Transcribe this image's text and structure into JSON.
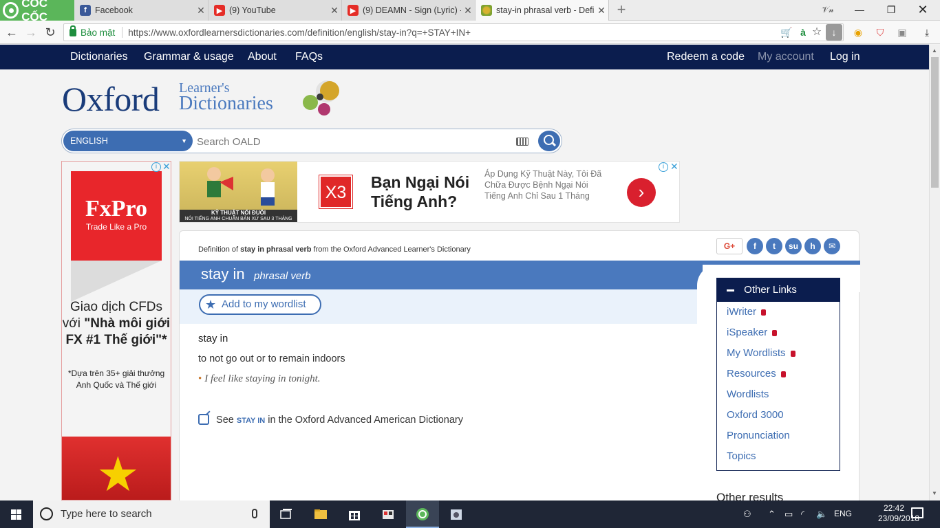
{
  "browser": {
    "brand": "CỐC CỐC",
    "tabs": [
      {
        "title": "Facebook",
        "icon": "facebook-icon"
      },
      {
        "title": "(9) YouTube",
        "icon": "youtube-icon"
      },
      {
        "title": "(9) DEAMN - Sign (Lyric) -",
        "icon": "youtube-icon"
      },
      {
        "title": "stay-in phrasal verb - Defin",
        "icon": "oxford-icon"
      }
    ],
    "secure_label": "Bảo mật",
    "url": "https://www.oxfordlearnersdictionaries.com/definition/english/stay-in?q=+STAY+IN+",
    "colors": {
      "brand_green": "#5bb65a",
      "secure_green": "#1e8e3e"
    }
  },
  "sitenav": {
    "left": [
      "Dictionaries",
      "Grammar & usage",
      "About",
      "FAQs"
    ],
    "right": [
      "Redeem a code",
      "My account",
      "Log in"
    ]
  },
  "logo": {
    "oxford": "Oxford",
    "learners": "Learner's",
    "dictionaries": "Dictionaries"
  },
  "search": {
    "language": "ENGLISH",
    "placeholder": "Search OALD"
  },
  "left_ad": {
    "brand": "FxPro",
    "tagline": "Trade Like a Pro",
    "headline": "Giao dịch CFDs với \"Nhà môi giới FX #1 Thế giới\"*",
    "headline_plain": "Giao dịch CFDs với",
    "headline_bold": "\"Nhà môi giới FX #1 Thế giới\"*",
    "footnote": "*Dựa trên 35+ giải thưởng Anh Quốc và Thế giới"
  },
  "top_ad": {
    "image_caption": "KỸ THUẬT NÓI ĐUÔI",
    "image_subcaption": "NÓI TIẾNG ANH CHUẨN BẢN XỨ SAU 3 THÁNG",
    "logo": "X3",
    "headline": "Bạn Ngại Nói Tiếng Anh?",
    "body": "Áp Dụng Kỹ Thuật Này, Tôi Đã Chữa Được Bệnh Ngại Nói Tiếng Anh Chỉ Sau 1 Tháng",
    "go": "›"
  },
  "entry": {
    "source_prefix": "Definition of",
    "source_word": "stay in phrasal verb",
    "source_suffix": "from the Oxford Advanced Learner's Dictionary",
    "headword": "stay in",
    "pos": "phrasal verb",
    "wordlist_button": "Add to my wordlist",
    "sense_headword": "stay in",
    "definition": "to not go out or to remain indoors",
    "example": "I feel like staying in tonight.",
    "see_prefix": "See",
    "see_link": "STAY IN",
    "see_suffix": "in the Oxford Advanced American Dictionary",
    "share": [
      "G+",
      "f",
      "t",
      "su",
      "h",
      "✉"
    ],
    "colors": {
      "accent": "#4a79be",
      "navy": "#0b1d4e",
      "bullet": "#c87528"
    }
  },
  "other_links": {
    "title": "Other Links",
    "items": [
      {
        "label": "iWriter",
        "locked": true
      },
      {
        "label": "iSpeaker",
        "locked": true
      },
      {
        "label": "My Wordlists",
        "locked": true
      },
      {
        "label": "Resources",
        "locked": true
      },
      {
        "label": "Wordlists",
        "locked": false
      },
      {
        "label": "Oxford 3000",
        "locked": false
      },
      {
        "label": "Pronunciation",
        "locked": false
      },
      {
        "label": "Topics",
        "locked": false
      }
    ],
    "other_results": "Other results"
  },
  "taskbar": {
    "search_placeholder": "Type here to search",
    "language": "ENG",
    "time": "22:42",
    "date": "23/09/2018"
  }
}
